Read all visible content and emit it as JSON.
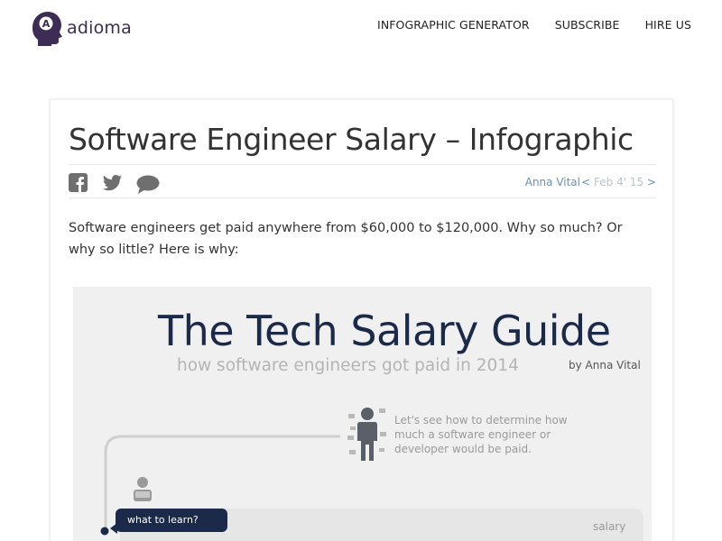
{
  "header": {
    "logo_text": "adioma",
    "nav": [
      {
        "label": "INFOGRAPHIC GENERATOR"
      },
      {
        "label": "SUBSCRIBE"
      },
      {
        "label": "HIRE US"
      }
    ]
  },
  "post": {
    "title": "Software Engineer Salary – Infographic",
    "author": "Anna Vital",
    "date": "Feb 4' 15",
    "prev_arrow": "<",
    "next_arrow": ">",
    "share_icons": [
      "facebook-icon",
      "twitter-icon",
      "comment-icon"
    ],
    "intro": "Software engineers get paid anywhere from $60,000 to $120,000. Why so much? Or why so little? Here is why:"
  },
  "infographic": {
    "title": "The Tech Salary Guide",
    "subtitle": "how software engineers got paid in 2014",
    "byline": "by Anna Vital",
    "caption": "Let's see how to determine how much a software engineer or developer would be paid.",
    "question": "what to learn?",
    "panel_label": "salary"
  },
  "colors": {
    "brand": "#3d2c55",
    "link": "#6a8fb3",
    "infographic_navy": "#1c2a4a",
    "infographic_bg": "#f0f0f0"
  }
}
